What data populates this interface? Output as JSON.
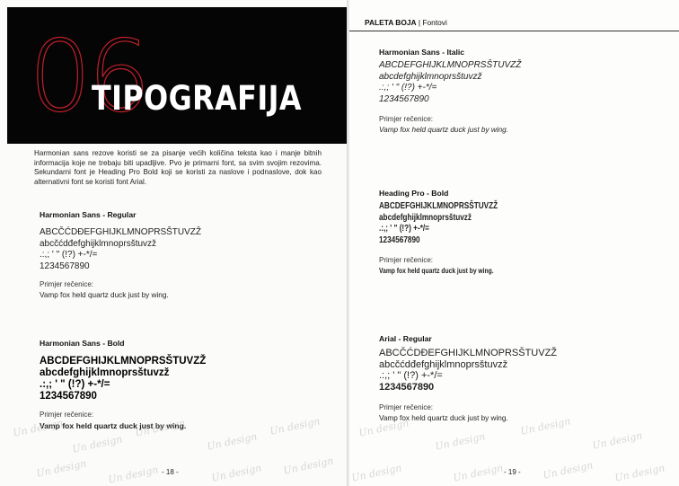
{
  "left_page": {
    "hero": {
      "number": "06",
      "title": "TIPOGRAFIJA"
    },
    "intro": "Harmonian sans rezove koristi se za pisanje većih količina teksta kao i manje bitnih informacija koje ne trebaju biti upadljive. Pvo je primarni font, sa svim svojim rezovima. Sekundarni font je Heading Pro Bold koji se koristi za naslove i podnaslove, dok kao alternativni font se koristi font Arial.",
    "fonts": [
      {
        "heading": "Harmonian Sans - Regular",
        "upper": "ABCČĆDĐEFGHIJKLMNOPRSŠTUVZŽ",
        "lower": "abcčćdđefghijklmnoprsštuvzž",
        "symbols": ".:,; ' \" (!?) +-*/=",
        "digits": "1234567890",
        "sample_label": "Primjer rečenice:",
        "sample": "Vamp fox held quartz duck just by wing."
      },
      {
        "heading": "Harmonian Sans - Bold",
        "upper": "ABCDEFGHIJKLMNOPRSŠTUVZŽ",
        "lower": "abcdefghijklmnoprsštuvzž",
        "symbols": ".:,; ' \" (!?) +-*/=",
        "digits": "1234567890",
        "sample_label": "Primjer rečenice:",
        "sample": "Vamp fox held quartz duck just by wing."
      }
    ],
    "page_number": "- 18 -"
  },
  "right_page": {
    "header_bold": "PALETA BOJA",
    "header_sep": " | ",
    "header_light": "Fontovi",
    "fonts": [
      {
        "heading": "Harmonian Sans - Italic",
        "upper": "ABCDEFGHIJKLMNOPRSŠTUVZŽ",
        "lower": "abcdefghijklmnoprsštuvzž",
        "symbols": ".:,; ' \" (!?) +-*/=",
        "digits": "1234567890",
        "sample_label": "Primjer rečenice:",
        "sample": "Vamp fox held quartz duck just by wing."
      },
      {
        "heading": "Heading Pro - Bold",
        "upper": "ABCDEFGHIJKLMNOPRSŠTUVZŽ",
        "lower": "abcdefghijklmnoprsštuvzž",
        "symbols": ".:,; ' \" (!?) +-*/=",
        "digits": "1234567890",
        "sample_label": "Primjer rečenice:",
        "sample": "Vamp fox held quartz duck just by wing."
      },
      {
        "heading": "Arial - Regular",
        "upper": "ABCČĆDĐEFGHIJKLMNOPRSŠTUVZŽ",
        "lower": "abcčćdđefghijklmnoprsštuvzž",
        "symbols": ".:,; ' \" (!?) +-*/=",
        "digits": "1234567890",
        "sample_label": "Primjer rečenice:",
        "sample": "Vamp fox held quartz duck just by wing."
      }
    ],
    "page_number": "- 19 -"
  },
  "watermark": "Un design",
  "colors": {
    "accent": "#c0202a",
    "hero_bg": "#050505"
  }
}
